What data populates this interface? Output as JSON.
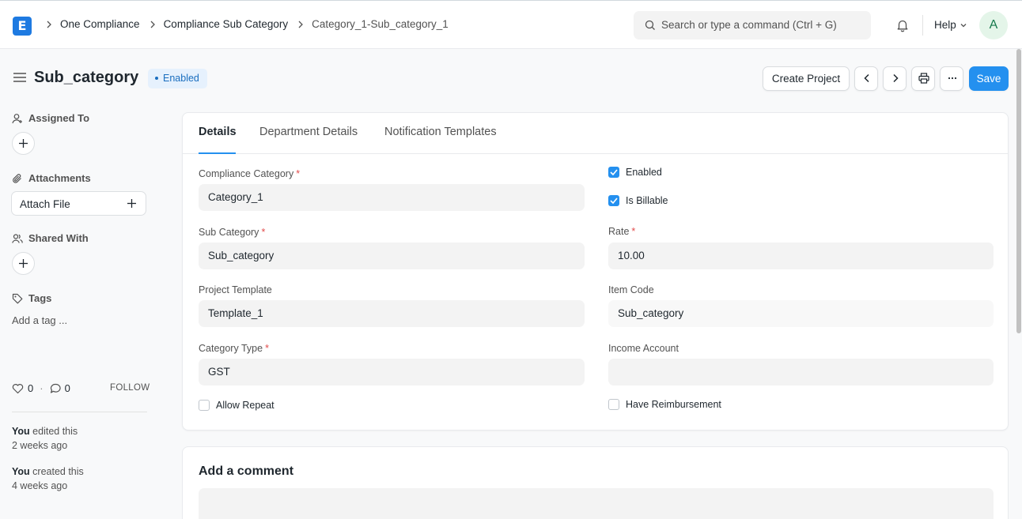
{
  "navbar": {
    "logo_letter": "E",
    "breadcrumbs": [
      "One Compliance",
      "Compliance Sub Category",
      "Category_1-Sub_category_1"
    ],
    "search_placeholder": "Search or type a command (Ctrl + G)",
    "help_label": "Help",
    "avatar_initial": "A"
  },
  "header": {
    "title": "Sub_category",
    "status": "Enabled",
    "create_project_label": "Create Project",
    "save_label": "Save"
  },
  "sidebar": {
    "assigned_to_label": "Assigned To",
    "attachments_label": "Attachments",
    "attach_file_label": "Attach File",
    "shared_with_label": "Shared With",
    "tags_label": "Tags",
    "add_tag_label": "Add a tag ...",
    "likes_count": "0",
    "comments_count": "0",
    "follow_label": "FOLLOW",
    "activity": [
      {
        "actor": "You",
        "action": " edited this",
        "time": "2 weeks ago"
      },
      {
        "actor": "You",
        "action": " created this",
        "time": "4 weeks ago"
      }
    ]
  },
  "tabs": [
    "Details",
    "Department Details",
    "Notification Templates"
  ],
  "form": {
    "compliance_category": {
      "label": "Compliance Category",
      "value": "Category_1"
    },
    "sub_category": {
      "label": "Sub Category",
      "value": "Sub_category"
    },
    "project_template": {
      "label": "Project Template",
      "value": "Template_1"
    },
    "category_type": {
      "label": "Category Type",
      "value": "GST"
    },
    "allow_repeat": {
      "label": "Allow Repeat",
      "checked": false
    },
    "enabled": {
      "label": "Enabled",
      "checked": true
    },
    "is_billable": {
      "label": "Is Billable",
      "checked": true
    },
    "rate": {
      "label": "Rate",
      "value": "10.00"
    },
    "item_code": {
      "label": "Item Code",
      "value": "Sub_category"
    },
    "income_account": {
      "label": "Income Account",
      "value": ""
    },
    "have_reimbursement": {
      "label": "Have Reimbursement",
      "checked": false
    }
  },
  "comment": {
    "title": "Add a comment"
  },
  "colors": {
    "primary": "#2490ef",
    "brand": "#1e7ae1",
    "required": "#e24c4c"
  }
}
